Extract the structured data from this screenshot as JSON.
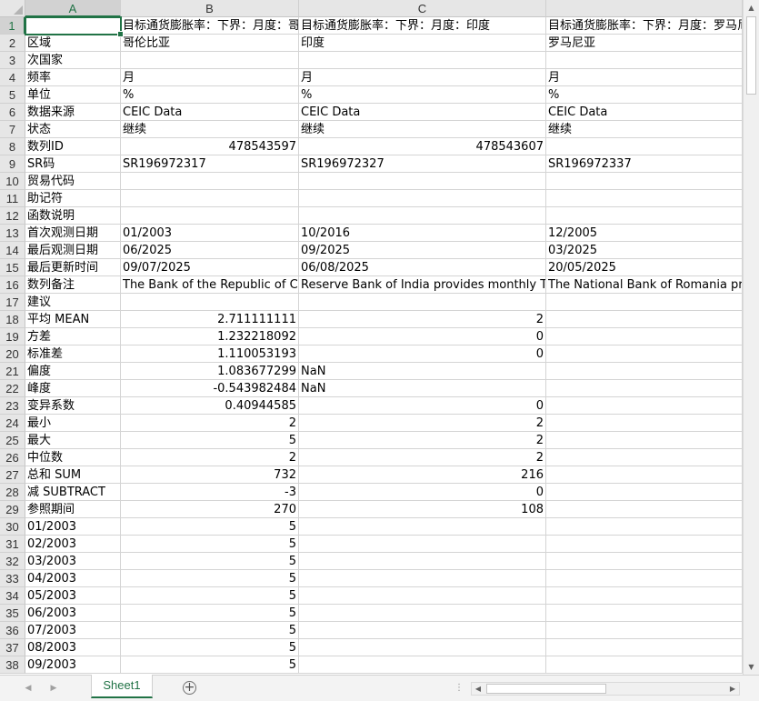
{
  "sheet": {
    "columns": [
      "A",
      "B",
      "C",
      ""
    ],
    "selected_cell": "A1",
    "rows": [
      {
        "n": "1",
        "a": "",
        "b": "目标通货膨胀率：下界：月度：哥伦比亚",
        "c": "目标通货膨胀率：下界：月度：印度",
        "d": "目标通货膨胀率：下界：月度：罗马尼亚",
        "bt": "txt",
        "ct": "txt"
      },
      {
        "n": "2",
        "a": "区域",
        "b": "哥伦比亚",
        "c": "印度",
        "d": "罗马尼亚",
        "bt": "txt",
        "ct": "txt"
      },
      {
        "n": "3",
        "a": "次国家",
        "b": "",
        "c": "",
        "d": "",
        "bt": "txt",
        "ct": "txt"
      },
      {
        "n": "4",
        "a": "频率",
        "b": "月",
        "c": "月",
        "d": "月",
        "bt": "txt",
        "ct": "txt"
      },
      {
        "n": "5",
        "a": "单位",
        "b": "%",
        "c": "%",
        "d": "%",
        "bt": "txt",
        "ct": "txt"
      },
      {
        "n": "6",
        "a": "数据来源",
        "b": "CEIC Data",
        "c": "CEIC Data",
        "d": "CEIC Data",
        "bt": "txt",
        "ct": "txt"
      },
      {
        "n": "7",
        "a": "状态",
        "b": "继续",
        "c": "继续",
        "d": "继续",
        "bt": "txt",
        "ct": "txt"
      },
      {
        "n": "8",
        "a": "数列ID",
        "b": "478543597",
        "c": "478543607",
        "d": "",
        "bt": "num",
        "ct": "num"
      },
      {
        "n": "9",
        "a": "SR码",
        "b": "SR196972317",
        "c": "SR196972327",
        "d": "SR196972337",
        "bt": "txt",
        "ct": "txt"
      },
      {
        "n": "10",
        "a": "贸易代码",
        "b": "",
        "c": "",
        "d": "",
        "bt": "txt",
        "ct": "txt"
      },
      {
        "n": "11",
        "a": "助记符",
        "b": "",
        "c": "",
        "d": "",
        "bt": "txt",
        "ct": "txt"
      },
      {
        "n": "12",
        "a": "函数说明",
        "b": "",
        "c": "",
        "d": "",
        "bt": "txt",
        "ct": "txt"
      },
      {
        "n": "13",
        "a": "首次观测日期",
        "b": "01/2003",
        "c": "10/2016",
        "d": "12/2005",
        "bt": "txt",
        "ct": "txt"
      },
      {
        "n": "14",
        "a": "最后观测日期",
        "b": "06/2025",
        "c": "09/2025",
        "d": "03/2025",
        "bt": "txt",
        "ct": "txt"
      },
      {
        "n": "15",
        "a": "最后更新时间",
        "b": "09/07/2025",
        "c": "06/08/2025",
        "d": "20/05/2025",
        "bt": "txt",
        "ct": "txt"
      },
      {
        "n": "16",
        "a": "数列备注",
        "b": "The Bank of the Republic of Colombia",
        "c": "Reserve Bank of India provides monthly Target",
        "d": "The National Bank of Romania provides",
        "bt": "txt",
        "ct": "txt"
      },
      {
        "n": "17",
        "a": "建议",
        "b": "",
        "c": "",
        "d": "",
        "bt": "txt",
        "ct": "txt"
      },
      {
        "n": "18",
        "a": "平均 MEAN",
        "b": "2.711111111",
        "c": "2",
        "d": "",
        "bt": "num",
        "ct": "num"
      },
      {
        "n": "19",
        "a": "方差",
        "b": "1.232218092",
        "c": "0",
        "d": "",
        "bt": "num",
        "ct": "num"
      },
      {
        "n": "20",
        "a": "标准差",
        "b": "1.110053193",
        "c": "0",
        "d": "",
        "bt": "num",
        "ct": "num"
      },
      {
        "n": "21",
        "a": "偏度",
        "b": "1.083677299",
        "c": "NaN",
        "d": "",
        "bt": "num",
        "ct": "txt"
      },
      {
        "n": "22",
        "a": "峰度",
        "b": "-0.543982484",
        "c": "NaN",
        "d": "",
        "bt": "num",
        "ct": "txt"
      },
      {
        "n": "23",
        "a": "变异系数",
        "b": "0.40944585",
        "c": "0",
        "d": "",
        "bt": "num",
        "ct": "num"
      },
      {
        "n": "24",
        "a": "最小",
        "b": "2",
        "c": "2",
        "d": "",
        "bt": "num",
        "ct": "num"
      },
      {
        "n": "25",
        "a": "最大",
        "b": "5",
        "c": "2",
        "d": "",
        "bt": "num",
        "ct": "num"
      },
      {
        "n": "26",
        "a": "中位数",
        "b": "2",
        "c": "2",
        "d": "",
        "bt": "num",
        "ct": "num"
      },
      {
        "n": "27",
        "a": "总和 SUM",
        "b": "732",
        "c": "216",
        "d": "",
        "bt": "num",
        "ct": "num"
      },
      {
        "n": "28",
        "a": "减 SUBTRACT",
        "b": "-3",
        "c": "0",
        "d": "",
        "bt": "num",
        "ct": "num"
      },
      {
        "n": "29",
        "a": "参照期间",
        "b": "270",
        "c": "108",
        "d": "",
        "bt": "num",
        "ct": "num"
      },
      {
        "n": "30",
        "a": "01/2003",
        "b": "5",
        "c": "",
        "d": "",
        "bt": "num",
        "ct": "num"
      },
      {
        "n": "31",
        "a": "02/2003",
        "b": "5",
        "c": "",
        "d": "",
        "bt": "num",
        "ct": "num"
      },
      {
        "n": "32",
        "a": "03/2003",
        "b": "5",
        "c": "",
        "d": "",
        "bt": "num",
        "ct": "num"
      },
      {
        "n": "33",
        "a": "04/2003",
        "b": "5",
        "c": "",
        "d": "",
        "bt": "num",
        "ct": "num"
      },
      {
        "n": "34",
        "a": "05/2003",
        "b": "5",
        "c": "",
        "d": "",
        "bt": "num",
        "ct": "num"
      },
      {
        "n": "35",
        "a": "06/2003",
        "b": "5",
        "c": "",
        "d": "",
        "bt": "num",
        "ct": "num"
      },
      {
        "n": "36",
        "a": "07/2003",
        "b": "5",
        "c": "",
        "d": "",
        "bt": "num",
        "ct": "num"
      },
      {
        "n": "37",
        "a": "08/2003",
        "b": "5",
        "c": "",
        "d": "",
        "bt": "num",
        "ct": "num"
      },
      {
        "n": "38",
        "a": "09/2003",
        "b": "5",
        "c": "",
        "d": "",
        "bt": "num",
        "ct": "num"
      }
    ]
  },
  "footer": {
    "sheet_tab": "Sheet1",
    "add_sheet_icon": "+",
    "nav_prev_icon": "◀",
    "nav_next_icon": "▶",
    "split_icon": "⋮"
  },
  "scroll": {
    "up_icon": "▲",
    "down_icon": "▼",
    "left_icon": "◀",
    "right_icon": "▶"
  },
  "colors": {
    "accent": "#217346",
    "header_bg": "#e6e6e6",
    "gridline": "#d4d4d4"
  }
}
